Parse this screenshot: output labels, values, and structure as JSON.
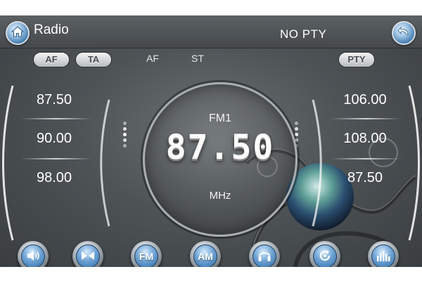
{
  "header": {
    "title": "Radio",
    "pty_status": "NO PTY",
    "home_icon": "home-icon",
    "back_icon": "back-arrow-icon"
  },
  "toggles": {
    "af": "AF",
    "ta": "TA",
    "pty": "PTY"
  },
  "indicators": {
    "af": "AF",
    "st": "ST"
  },
  "presets_left": [
    "87.50",
    "90.00",
    "98.00"
  ],
  "presets_right": [
    "106.00",
    "108.00",
    "87.50"
  ],
  "tuner": {
    "band": "FM1",
    "frequency": "87.50",
    "unit": "MHz"
  },
  "bottom_buttons": [
    {
      "name": "volume-button",
      "icon": "speaker-icon",
      "label": ""
    },
    {
      "name": "seek-button",
      "icon": "seek-icon",
      "label": ""
    },
    {
      "name": "fm-button",
      "icon": "",
      "label": "FM"
    },
    {
      "name": "am-button",
      "icon": "",
      "label": "AM"
    },
    {
      "name": "headphones-button",
      "icon": "headphones-icon",
      "label": ""
    },
    {
      "name": "scan-button",
      "icon": "refresh-icon",
      "label": ""
    },
    {
      "name": "equalizer-button",
      "icon": "equalizer-icon",
      "label": ""
    }
  ],
  "colors": {
    "accent_blue": "#3f78ad",
    "background": "#4e5356",
    "text": "#ffffff"
  }
}
